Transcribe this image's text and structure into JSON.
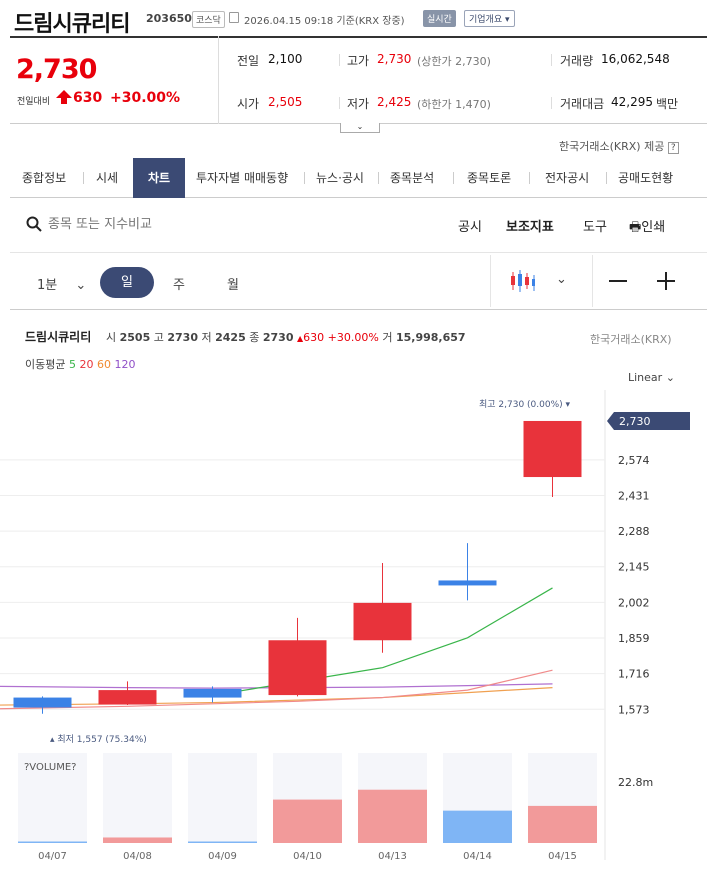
{
  "header": {
    "title": "드림시큐리티",
    "code": "203650",
    "market_tag": "코스닥",
    "date": "2026.04.15 09:18 기준(KRX 장중)",
    "realtime": "실시간",
    "company_info": "기업개요"
  },
  "quote": {
    "price": "2,730",
    "change_label": "전일대비",
    "change": "630",
    "change_pct": "+30.00%",
    "prev_label": "전일",
    "prev": "2,100",
    "high_label": "고가",
    "high": "2,730",
    "upper_limit": "(상한가 2,730)",
    "volume_label": "거래량",
    "volume": "16,062,548",
    "open_label": "시가",
    "open": "2,505",
    "low_label": "저가",
    "low": "2,425",
    "lower_limit": "(하한가 1,470)",
    "amount_label": "거래대금",
    "amount": "42,295",
    "amount_unit": "백만"
  },
  "provider": "한국거래소(KRX) 제공",
  "tabs": [
    "종합정보",
    "시세",
    "차트",
    "투자자별 매매동향",
    "뉴스·공시",
    "종목분석",
    "종목토론",
    "전자공시",
    "공매도현황"
  ],
  "active_tab": "차트",
  "search": {
    "placeholder": "종목 또는 지수비교"
  },
  "tools": {
    "disclosure": "공시",
    "indicators": "보조지표",
    "tools": "도구",
    "print": "인쇄"
  },
  "periods": {
    "minute": "1분",
    "day": "일",
    "week": "주",
    "month": "월"
  },
  "chart_info": {
    "name": "드림시큐리티",
    "open_label": "시",
    "open": "2505",
    "high_label": "고",
    "high": "2730",
    "low_label": "저",
    "low": "2425",
    "close_label": "종",
    "close": "2730",
    "change": "630",
    "change_pct": "+30.00%",
    "volume_label": "거",
    "volume": "15,998,657",
    "exchange": "한국거래소(KRX)",
    "ma_label": "이동평균",
    "ma_periods": [
      "5",
      "20",
      "60",
      "120"
    ],
    "scale": "Linear"
  },
  "colors": {
    "up": "#e8333b",
    "down": "#3b82e6",
    "ma5": "#39b54a",
    "ma20": "#f08a8a",
    "ma60": "#f0a050",
    "ma120": "#b070d0",
    "accent": "#3b4a74"
  },
  "chart_data": {
    "type": "candlestick",
    "categories": [
      "04/07",
      "04/08",
      "04/09",
      "04/10",
      "04/13",
      "04/14",
      "04/15"
    ],
    "ohlc": [
      {
        "open": 1620,
        "high": 1625,
        "low": 1555,
        "close": 1580
      },
      {
        "open": 1592,
        "high": 1685,
        "low": 1590,
        "close": 1650
      },
      {
        "open": 1655,
        "high": 1665,
        "low": 1600,
        "close": 1620
      },
      {
        "open": 1630,
        "high": 1940,
        "low": 1625,
        "close": 1850
      },
      {
        "open": 1850,
        "high": 2160,
        "low": 1800,
        "close": 2000
      },
      {
        "open": 2090,
        "high": 2240,
        "low": 2010,
        "close": 2070
      },
      {
        "open": 2505,
        "high": 2730,
        "low": 2425,
        "close": 2730
      }
    ],
    "ma5": [
      null,
      null,
      null,
      null,
      1640,
      1740,
      1860,
      2060
    ],
    "ma20": [
      1575,
      1585,
      1595,
      1605,
      1620,
      1650,
      1730
    ],
    "ma60": [
      1590,
      1595,
      1600,
      1610,
      1620,
      1640,
      1660
    ],
    "ma120": [
      1665,
      1660,
      1658,
      1660,
      1662,
      1668,
      1675
    ],
    "ma5_values": [
      1640,
      1740,
      1860,
      2060
    ],
    "y_ticks": [
      "2,574",
      "2,431",
      "2,288",
      "2,145",
      "2,002",
      "1,859",
      "1,716",
      "1,573"
    ],
    "y_tick_values": [
      2574,
      2431,
      2288,
      2145,
      2002,
      1859,
      1716,
      1573
    ],
    "current_price_label": "2,730",
    "max_label": "최고 2,730 (0.00%)",
    "min_label": "최저 1,557 (75.34%)",
    "ylim": [
      1530,
      2770
    ],
    "volume_title": "?VOLUME?",
    "volume_max_label": "22.8m",
    "volume_max": 22800000,
    "volumes": [
      300000,
      1400000,
      200000,
      11000000,
      13500000,
      8200000,
      9400000
    ],
    "volume_dirs": [
      "down",
      "up",
      "down",
      "up",
      "up",
      "down",
      "up"
    ]
  }
}
